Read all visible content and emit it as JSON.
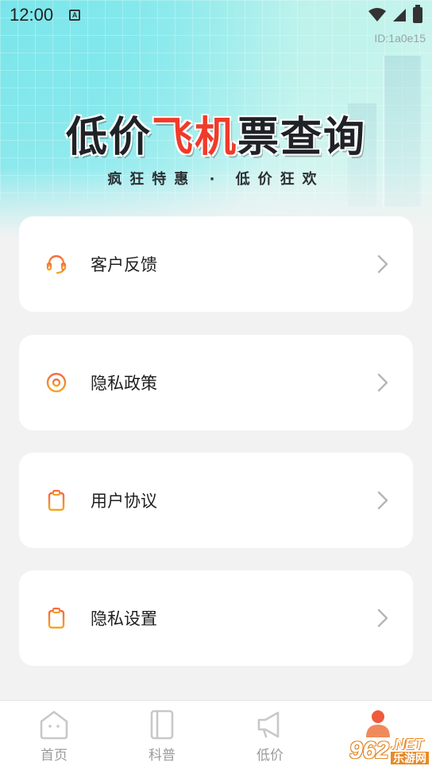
{
  "status_bar": {
    "time": "12:00",
    "notif_badge": "A"
  },
  "device_id": "ID:1a0e15",
  "hero": {
    "title_part1": "低价",
    "title_highlight": "飞机",
    "title_part2": "票查询",
    "subtitle": "疯狂特惠 · 低价狂欢"
  },
  "menu": [
    {
      "label": "客户反馈",
      "icon": "headset-icon"
    },
    {
      "label": "隐私政策",
      "icon": "privacy-ring-icon"
    },
    {
      "label": "用户协议",
      "icon": "clipboard-icon"
    },
    {
      "label": "隐私设置",
      "icon": "clipboard-icon"
    }
  ],
  "tabs": [
    {
      "label": "首页",
      "icon": "home-icon"
    },
    {
      "label": "科普",
      "icon": "book-icon"
    },
    {
      "label": "低价",
      "icon": "megaphone-icon"
    },
    {
      "label": "",
      "icon": "user-icon"
    }
  ],
  "watermark": {
    "num": "962",
    "net": ".NET",
    "cn": "乐游网"
  },
  "colors": {
    "accent": "#ef5a3b",
    "title_highlight": "#ef3b2a",
    "icon_gradient_start": "#f46b45",
    "icon_gradient_end": "#f5a623"
  }
}
